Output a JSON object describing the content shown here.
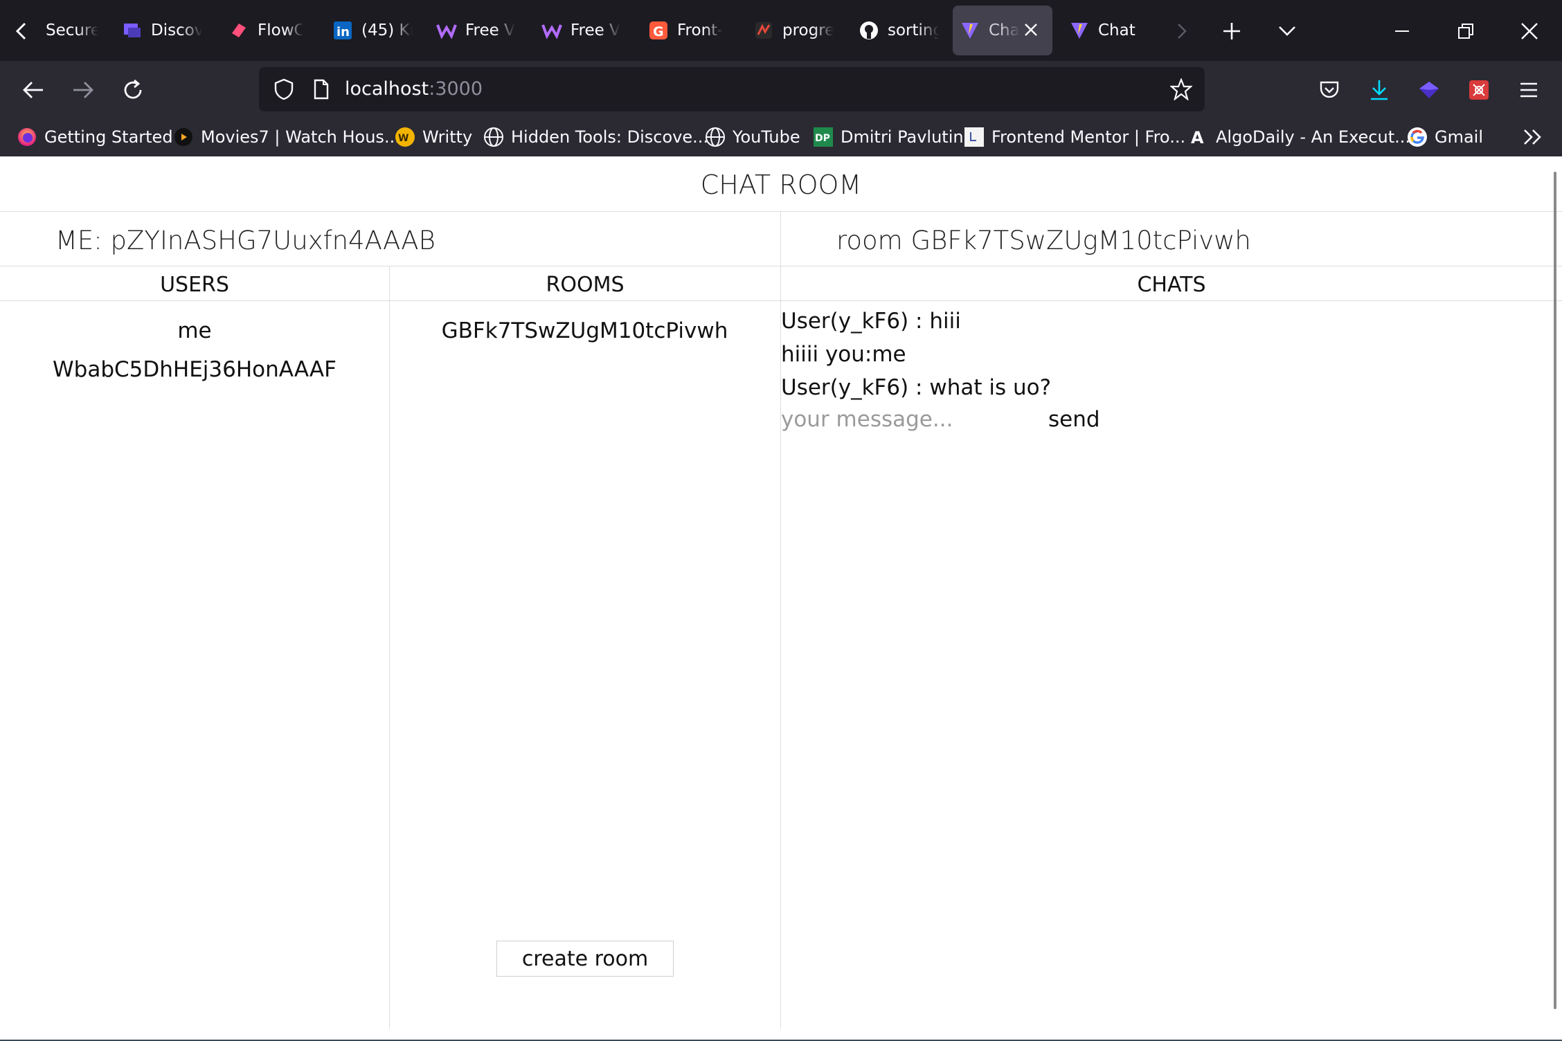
{
  "browser": {
    "tabs": [
      {
        "label": "Secure",
        "icon": "chevron-left-icon"
      },
      {
        "label": "Discov",
        "icon": "discord-like-icon",
        "color": "#7b5cff"
      },
      {
        "label": "FlowC",
        "icon": "flowcv-icon",
        "color": "#ff4f7b"
      },
      {
        "label": "(45) Kr",
        "icon": "linkedin-icon",
        "color": "#0a66c2"
      },
      {
        "label": "Free V",
        "icon": "w-logo-icon",
        "color": "#b36cff"
      },
      {
        "label": "Free V",
        "icon": "w-logo-icon",
        "color": "#b36cff"
      },
      {
        "label": "Front-",
        "icon": "g-logo-icon",
        "color": "#ff5a3c"
      },
      {
        "label": "progre",
        "icon": "progress-icon",
        "color": "#e8473b"
      },
      {
        "label": "sorting",
        "icon": "github-icon",
        "color": "#ffffff"
      },
      {
        "label": "Cha",
        "icon": "vite-icon",
        "active": true
      },
      {
        "label": "Chat",
        "icon": "vite-icon"
      }
    ],
    "url": {
      "host": "localhost",
      "port": ":3000"
    },
    "bookmarks": [
      {
        "label": "Getting Started",
        "icon": "firefox-icon"
      },
      {
        "label": "Movies7 | Watch Hous...",
        "icon": "play-icon"
      },
      {
        "label": "Writty",
        "icon": "writty-icon"
      },
      {
        "label": "Hidden Tools: Discove...",
        "icon": "globe-icon"
      },
      {
        "label": "YouTube",
        "icon": "globe-icon"
      },
      {
        "label": "Dmitri Pavlutin",
        "icon": "dp-icon",
        "badge": "DP"
      },
      {
        "label": "Frontend Mentor | Fro...",
        "icon": "frontend-mentor-icon"
      },
      {
        "label": "AlgoDaily - An Execut...",
        "icon": "algodaily-icon",
        "badge": "A"
      },
      {
        "label": "Gmail",
        "icon": "google-icon"
      }
    ],
    "colors": {
      "tabbar": "#1c1b22",
      "toolbar": "#2b2a33",
      "urlbar": "#1c1b22",
      "accent": "#00ddff"
    }
  },
  "app": {
    "title": "CHAT ROOM",
    "me_label": "ME: pZYInASHG7Uuxfn4AAAB",
    "room_label": "room GBFk7TSwZUgM10tcPivwh",
    "columns": {
      "users": "USERS",
      "rooms": "ROOMS",
      "chats": "CHATS"
    },
    "users": [
      "me",
      "WbabC5DhHEj36HonAAAF"
    ],
    "rooms": [
      "GBFk7TSwZUgM10tcPivwh"
    ],
    "messages": [
      "User(y_kF6) : hiii",
      "hiiii you:me",
      "User(y_kF6) : what is uo?"
    ],
    "input": {
      "placeholder": "your message...",
      "value": ""
    },
    "send_label": "send",
    "create_room_label": "create room"
  }
}
